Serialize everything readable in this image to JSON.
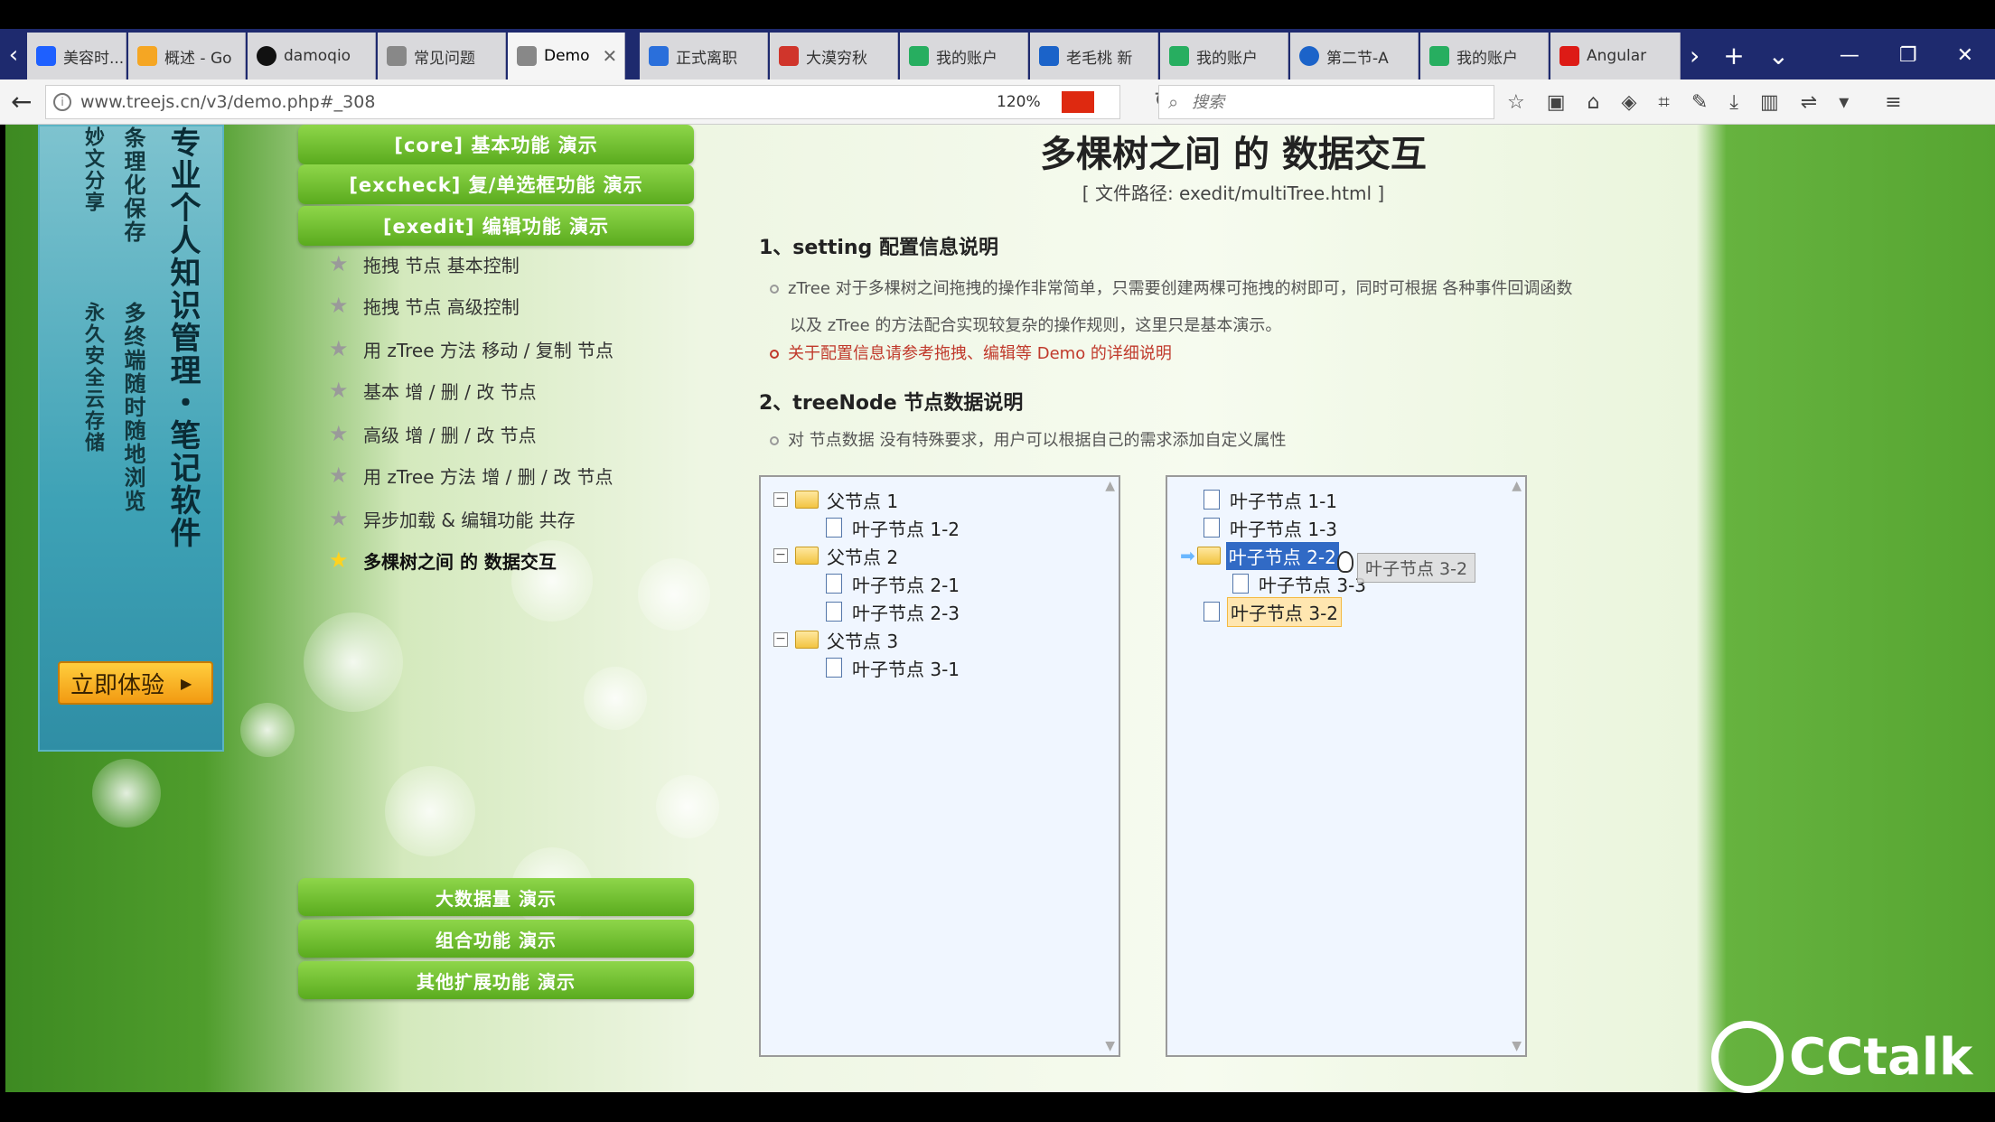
{
  "browser": {
    "tabs": [
      {
        "label": "美容时...",
        "color": "#1e60ff"
      },
      {
        "label": "概述 - Go",
        "color": "#f5a623"
      },
      {
        "label": "damoqio",
        "color": "#111111"
      },
      {
        "label": "常见问题",
        "color": "#888888"
      },
      {
        "label": "Demo",
        "color": "#888888",
        "active": true
      },
      {
        "label": "正式离职",
        "color": "#2a6fdb"
      },
      {
        "label": "大漠穷秋",
        "color": "#d0352b"
      },
      {
        "label": "我的账户",
        "color": "#27ae60"
      },
      {
        "label": "老毛桃 新",
        "color": "#1b63c9"
      },
      {
        "label": "我的账户",
        "color": "#27ae60"
      },
      {
        "label": "第二节-A",
        "color": "#1b63c9"
      },
      {
        "label": "我的账户",
        "color": "#27ae60"
      },
      {
        "label": "Angular",
        "color": "#dd1b16"
      }
    ],
    "url": "www.treejs.cn/v3/demo.php#_308",
    "zoom": "120%",
    "search_placeholder": "搜索"
  },
  "ad": {
    "title": "专业个人知识管理・笔记软件",
    "sub1": "条理化保存",
    "sub2": "多终端随时随地浏览",
    "sub3": "妙文分享",
    "sub4": "永久安全云存储",
    "button": "立即体验"
  },
  "menu": {
    "core": "[core] 基本功能 演示",
    "excheck": "[excheck] 复/单选框功能 演示",
    "exedit": "[exedit] 编辑功能 演示",
    "items": [
      "拖拽 节点 基本控制",
      "拖拽 节点 高级控制",
      "用 zTree 方法 移动 / 复制 节点",
      "基本 增 / 删 / 改 节点",
      "高级 增 / 删 / 改 节点",
      "用 zTree 方法 增 / 删 / 改 节点",
      "异步加载 & 编辑功能 共存",
      "多棵树之间 的 数据交互"
    ],
    "bottom": [
      "大数据量 演示",
      "组合功能 演示",
      "其他扩展功能 演示"
    ]
  },
  "content": {
    "title": "多棵树之间 的 数据交互",
    "file_path": "[ 文件路径: exedit/multiTree.html ]",
    "sec1_title": "1、setting 配置信息说明",
    "sec1_p1_a": "zTree 对于多棵树之间拖拽的操作非常简单，只需要创建两棵可拖拽的树即可，同时可根据 各种事件回调函数",
    "sec1_p1_b": "以及 zTree 的方法配合实现较复杂的操作规则，这里只是基本演示。",
    "sec1_p2": "关于配置信息请参考拖拽、编辑等 Demo 的详细说明",
    "sec2_title": "2、treeNode 节点数据说明",
    "sec2_p1": "对 节点数据 没有特殊要求，用户可以根据自己的需求添加自定义属性"
  },
  "tree1": {
    "p1": "父节点 1",
    "l12": "叶子节点 1-2",
    "p2": "父节点 2",
    "l21": "叶子节点 2-1",
    "l23": "叶子节点 2-3",
    "p3": "父节点 3",
    "l31": "叶子节点 3-1"
  },
  "tree2": {
    "l11": "叶子节点 1-1",
    "l13": "叶子节点 1-3",
    "p2": "叶子节点 2-2",
    "l33": "叶子节点 3-3",
    "l32": "叶子节点 3-2",
    "drag_ghost": "叶子节点 3-2"
  },
  "watermark": "CCtalk"
}
